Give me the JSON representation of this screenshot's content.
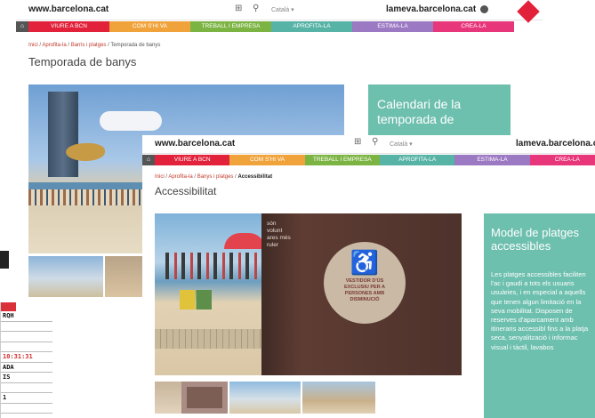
{
  "win1": {
    "site": "www.barcelona.cat",
    "grid_icon": "grid-icon",
    "search_icon": "search-icon",
    "lang": "Català ▾",
    "login": "lameva.barcelona.cat",
    "user_icon": "user-icon",
    "nav": [
      "VIURE A BCN",
      "COM S'HI VA",
      "TREBALL I EMPRESA",
      "APROFITA-LA",
      "ESTIMA-LA",
      "CREA-LA"
    ],
    "breadcrumb_links": [
      "Inici",
      "Aprofita-la",
      "Barris i platges"
    ],
    "breadcrumb_current": "Temporada de banys",
    "title": "Temporada de banys",
    "side_title": "Calendari de la temporada de"
  },
  "win2": {
    "site": "www.barcelona.cat",
    "lang": "Català ▾",
    "login": "lameva.barcelona.ca",
    "nav": [
      "VIURE A BCN",
      "COM S'HI VA",
      "TREBALL I EMPRESA",
      "APROFITA-LA",
      "ESTIMA-LA",
      "CREA-LA"
    ],
    "breadcrumb_links": [
      "Inici",
      "Aprofita-la",
      "Banys i platges"
    ],
    "breadcrumb_current": "Accessibilitat",
    "title": "Accessibilitat",
    "side_title": "Model de platges accessibles",
    "side_text": "Les platges accessibles faciliten l'ac i gaudi a tots els usuaris usuàries, i en especial a aquells que tenen algun limitació en la seva mobilitat. Disposen de reserves d'aparcament amb itineraris accessibl fins a la platja seca, senyalització i informac visual i tàctil, lavabos",
    "sign_left": "són volunt ares més ruler",
    "sign_circle": "VESTIDOR D'ÚS EXCLUSIU PER A PERSONES AMB DISMINUCIÓ"
  },
  "table": {
    "rows": [
      "RQH",
      "",
      "",
      "",
      "10:31:31",
      "ADA",
      "IS",
      "",
      "1",
      ""
    ]
  },
  "colors": {
    "red": "#e2213a",
    "orange": "#f1a33b",
    "green": "#7cb443",
    "teal": "#57b3a6",
    "purple": "#9c79c3",
    "pink": "#e8367a"
  }
}
